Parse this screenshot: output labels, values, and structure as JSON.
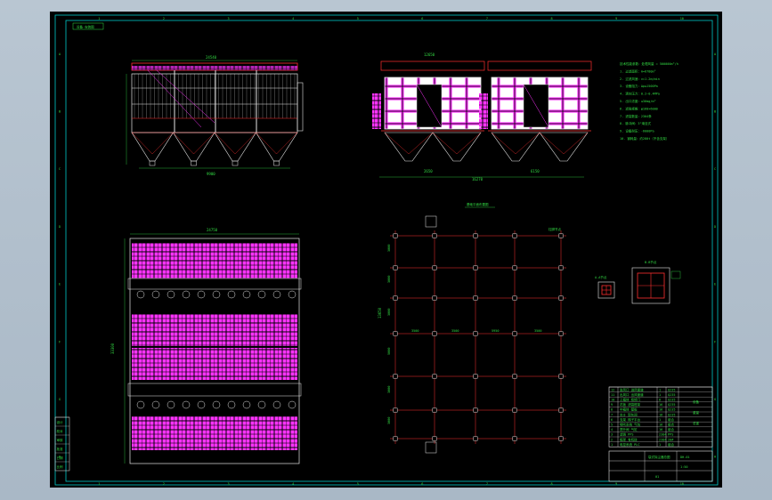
{
  "colors": {
    "background": "#000000",
    "frame": "#00c8c8",
    "line_green": "#33dd44",
    "line_white": "#e6e6e6",
    "line_red": "#ff3030",
    "fill_magenta": "#ff33ff",
    "line_yellow": "#e6e600",
    "window_chrome": "#b3c1cf"
  },
  "title_tag": "设备·安装图",
  "dims": {
    "elev_top": "24540",
    "elev_bottom": "9900",
    "plan_top": "24750",
    "plan_side": "33300",
    "right_top": "12650",
    "right_a": "2650",
    "right_b": "6150",
    "right_c": "16270",
    "grid_h": [
      "3500",
      "3500",
      "5950",
      "3500",
      "3500",
      "5950"
    ],
    "grid_v": [
      "3000",
      "3000",
      "3000",
      "5000",
      "3000",
      "3000"
    ],
    "grid_total_v": "13650"
  },
  "grid_labels": {
    "top_title": "基础平面布置图",
    "mid_title": "柱脚节点"
  },
  "detail_labels": {
    "left": "A-A节点",
    "right": "B-B节点"
  },
  "tech_notes": [
    "技术性能参数：处理风量 = 500000m³/h",
    "1. 过滤面积：A=6780m²",
    "2. 过滤风速：v=1.2m/min",
    "3. 设备阻力：Δp≤1500Pa",
    "4. 清灰压力：0.2~0.4MPa",
    "5. 出口浓度：≤30mg/m³",
    "6. 滤袋规格：φ160×6000",
    "7. 滤袋数量：2304条",
    "8. 脉冲阀：3\"淹没式",
    "9. 设备耐压：-6000Pa",
    "10. 钢耗量：约280t（不含支架）"
  ],
  "bom_rows": [
    [
      "12",
      "进风口 进风管道",
      "1",
      "Q235"
    ],
    [
      "11",
      "出风口 出风管道",
      "1",
      "Q235"
    ],
    [
      "10",
      "上箱体 检修门",
      "8",
      "Q235"
    ],
    [
      "9",
      "花板 滤袋框架",
      "16",
      "Q235"
    ],
    [
      "8",
      "中箱体 壁板",
      "16",
      "Q235"
    ],
    [
      "7",
      "灰斗 卸灰阀",
      "16",
      "Q235"
    ],
    [
      "6",
      "支架 梯子平台",
      "1",
      "组合"
    ],
    [
      "5",
      "喷吹系统 气包",
      "16",
      "组合"
    ],
    [
      "4",
      "提升阀 气缸",
      "16",
      "组合"
    ],
    [
      "3",
      "滤袋 PPS",
      "2304",
      "PPS"
    ],
    [
      "2",
      "框架 有机硅",
      "2304",
      "20#"
    ],
    [
      "1",
      "电控系统 PLC",
      "1",
      "组合"
    ]
  ],
  "bom_side_text": [
    "设备",
    "重量",
    "总重"
  ],
  "title_block": {
    "drawing_name": "袋式除尘器总图",
    "drawing_no": "DH-01",
    "sheet": "1:50",
    "revision": "01"
  },
  "left_block": [
    "设计",
    "校对",
    "审核",
    "批准",
    "日期",
    "比例"
  ],
  "border_cols": [
    "1",
    "2",
    "3",
    "4",
    "5",
    "6",
    "7",
    "8",
    "9",
    "10"
  ],
  "border_rows": [
    "A",
    "B",
    "C",
    "D",
    "E",
    "F",
    "G",
    "H"
  ]
}
